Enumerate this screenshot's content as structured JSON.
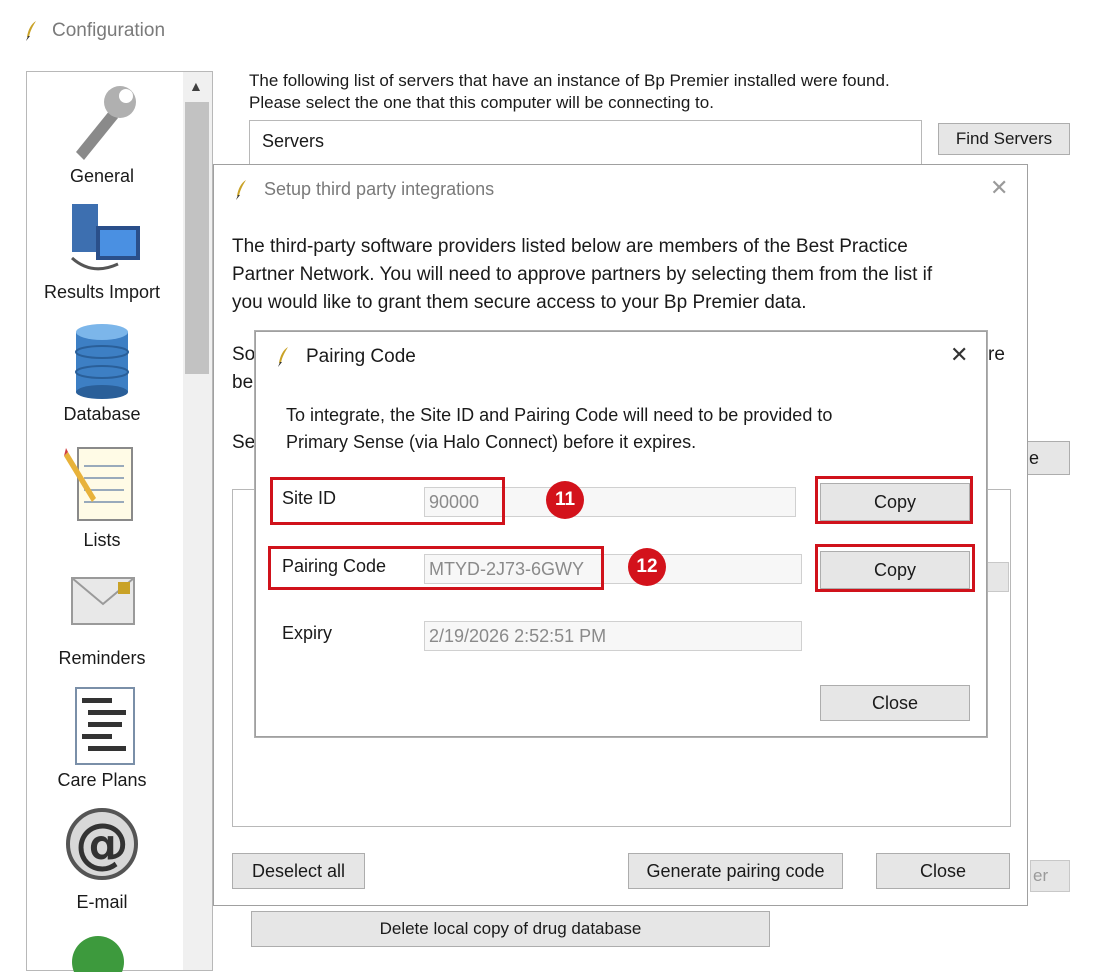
{
  "config_window": {
    "title": "Configuration",
    "intro_line1": "The following list of servers that have an instance of Bp Premier installed were found.",
    "intro_line2": "Please select the one that this computer will be connecting to.",
    "servers_header": "Servers",
    "find_servers_label": "Find Servers",
    "delete_drug_db_label": "Delete local copy of drug database",
    "partial_right_text_1": "re",
    "partial_right_text_2": "e",
    "partial_right_button": "er"
  },
  "sidebar": {
    "items": [
      {
        "label": "General",
        "icon": "wrench-icon"
      },
      {
        "label": "Results Import",
        "icon": "computer-icon"
      },
      {
        "label": "Database",
        "icon": "database-icon"
      },
      {
        "label": "Lists",
        "icon": "notepad-icon"
      },
      {
        "label": "Reminders",
        "icon": "envelope-icon"
      },
      {
        "label": "Care Plans",
        "icon": "document-icon"
      },
      {
        "label": "E-mail",
        "icon": "at-sign-icon"
      }
    ]
  },
  "integrations_dialog": {
    "title": "Setup third party integrations",
    "description": [
      "The third-party software providers listed below are members of the Best Practice",
      "Partner Network. You will need to approve partners by selecting them from the list if",
      "you would like to grant them secure access to your Bp Premier data."
    ],
    "partial_so": "So",
    "partial_be": "be",
    "partial_se": "Se",
    "deselect_all_label": "Deselect all",
    "generate_pairing_label": "Generate pairing code",
    "close_label": "Close"
  },
  "pairing_dialog": {
    "title": "Pairing Code",
    "description": [
      "To integrate, the Site ID and Pairing Code will need to be provided to",
      "Primary Sense (via Halo Connect) before it expires."
    ],
    "site_id_label": "Site ID",
    "site_id_value": "90000",
    "pairing_code_label": "Pairing Code",
    "pairing_code_value": "MTYD-2J73-6GWY",
    "expiry_label": "Expiry",
    "expiry_value": "2/19/2026 2:52:51 PM",
    "copy_label": "Copy",
    "close_label": "Close",
    "close_x": "✕"
  },
  "annotations": {
    "badge_site_id": "11",
    "badge_pairing_code": "12"
  },
  "colors": {
    "highlight": "#d0121b",
    "button_face": "#e6e6e6"
  }
}
